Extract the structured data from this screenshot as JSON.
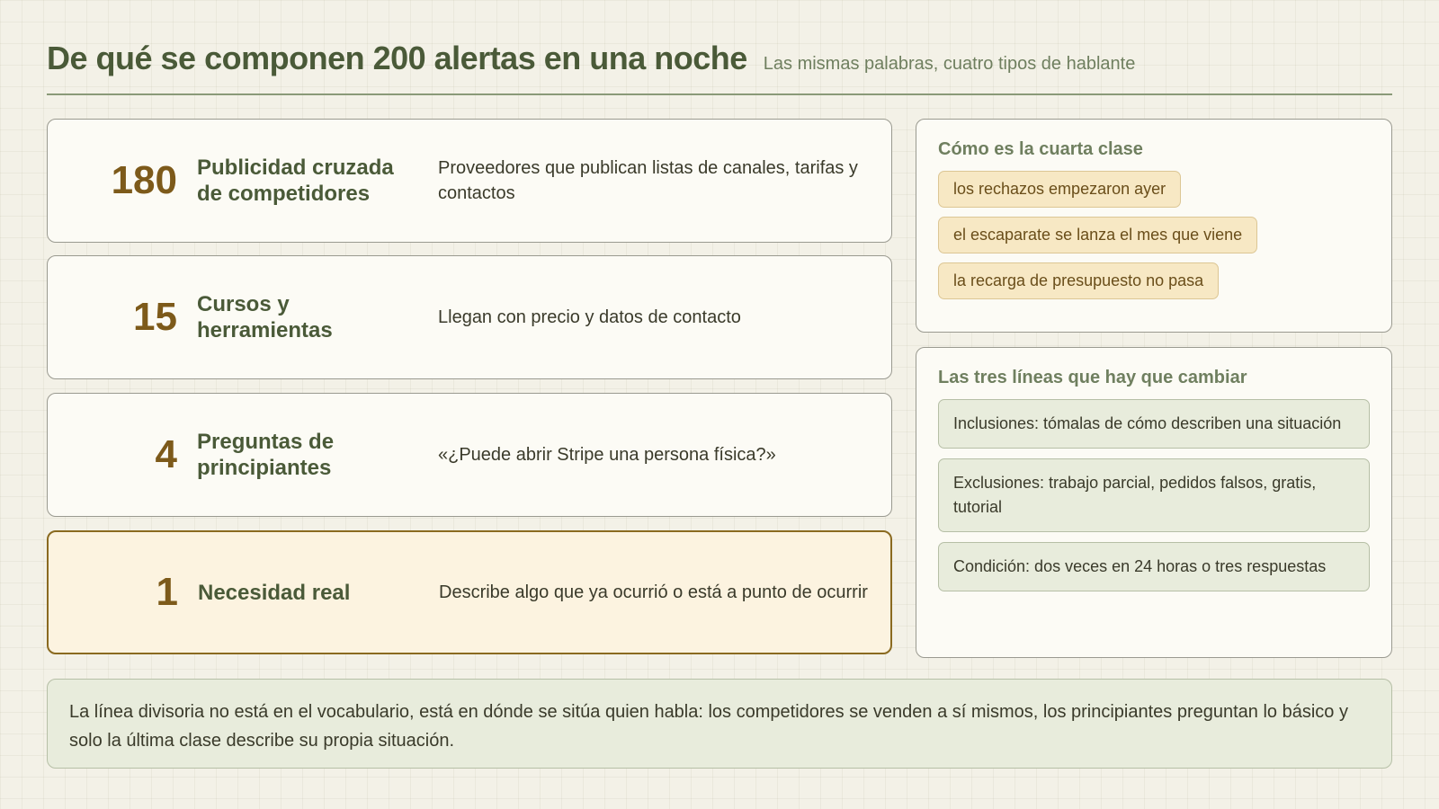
{
  "header": {
    "title": "De qué se componen 200 alertas en una noche",
    "subtitle": "Las mismas palabras, cuatro tipos de hablante"
  },
  "rows": [
    {
      "count": "180",
      "label": "Publicidad cruzada de competidores",
      "description": "Proveedores que publican listas de canales, tarifas y contactos"
    },
    {
      "count": "15",
      "label": "Cursos y herramientas",
      "description": "Llegan con precio y datos de contacto"
    },
    {
      "count": "4",
      "label": "Preguntas de principiantes",
      "description": "«¿Puede abrir Stripe una persona física?»"
    },
    {
      "count": "1",
      "label": "Necesidad real",
      "description": "Describe algo que ya ocurrió o está a punto de ocurrir"
    }
  ],
  "fourth_class": {
    "heading": "Cómo es la cuarta clase",
    "examples": [
      "los rechazos empezaron ayer",
      "el escaparate se lanza el mes que viene",
      "la recarga de presupuesto no pasa"
    ]
  },
  "changes": {
    "heading": "Las tres líneas que hay que cambiar",
    "items": [
      "Inclusiones: tómalas de cómo describen una situación",
      "Exclusiones: trabajo parcial, pedidos falsos, gratis, tutorial",
      "Condición: dos veces en 24 horas o tres respuestas"
    ]
  },
  "footer": {
    "text": "La línea divisoria no está en el vocabulario, está en dónde se sitúa quien habla: los competidores se venden a sí mismos, los principiantes preguntan lo básico y solo la última clase describe su propia situación."
  },
  "colors": {
    "accent_green": "#4a5a38",
    "count_brown": "#7d5a1a",
    "chip_bg": "#f7e8c4",
    "rule_bg": "#e8ecdc"
  }
}
